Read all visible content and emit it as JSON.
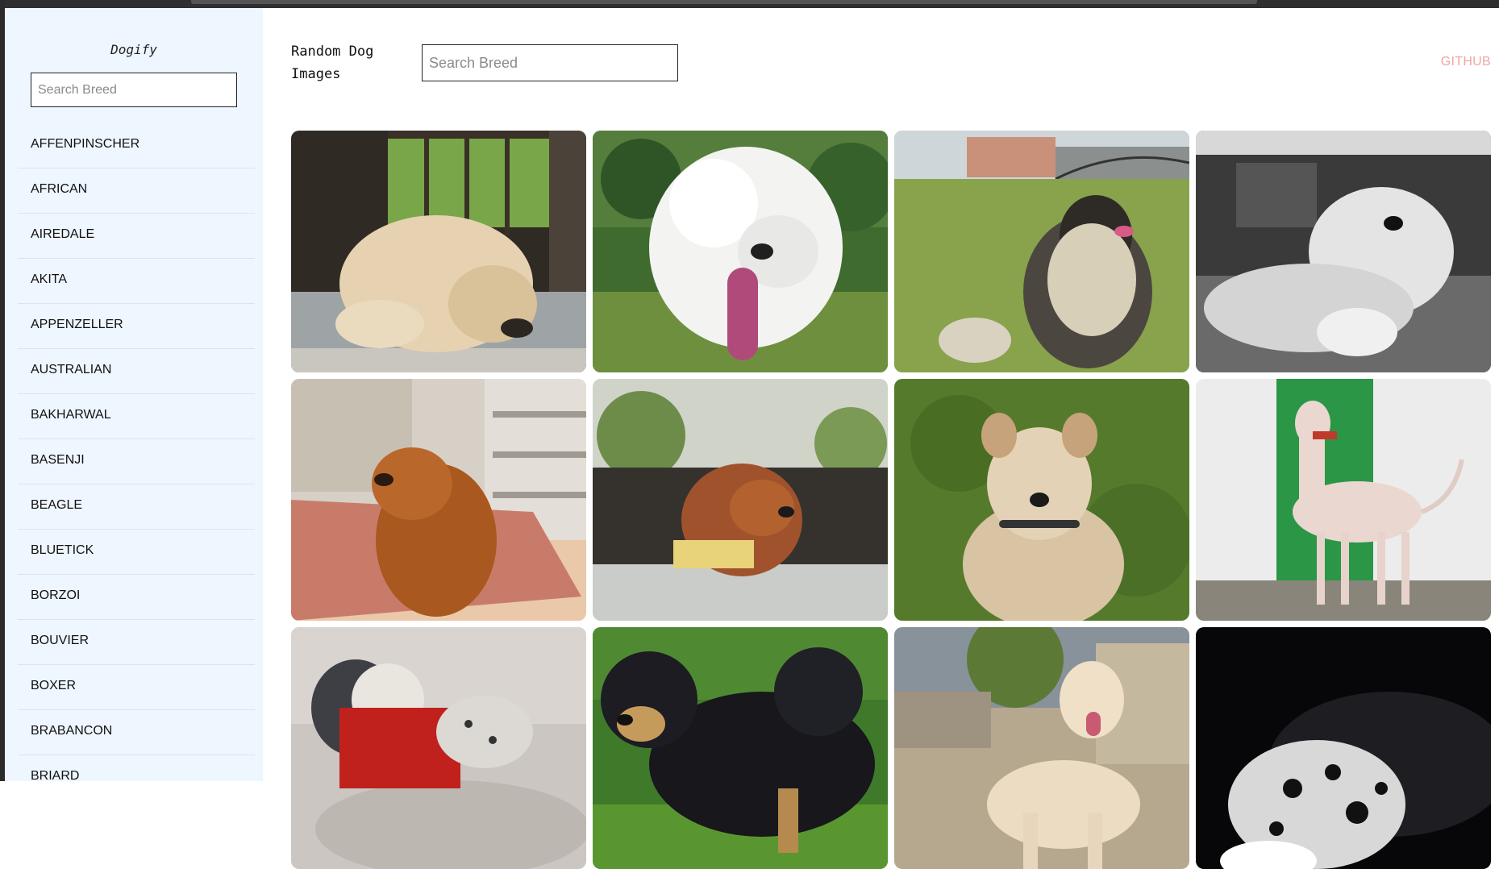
{
  "sidebar": {
    "title": "Dogify",
    "search_placeholder": "Search Breed",
    "breeds": [
      "affenpinscher",
      "african",
      "airedale",
      "akita",
      "appenzeller",
      "australian",
      "bakharwal",
      "basenji",
      "beagle",
      "bluetick",
      "borzoi",
      "bouvier",
      "boxer",
      "brabancon",
      "briard"
    ]
  },
  "header": {
    "title": "Random Dog Images",
    "search_placeholder": "Search Breed",
    "github_label": "GITHUB"
  },
  "colors": {
    "sidebar_bg": "#eef6ff",
    "github_link": "#f0a4a4"
  },
  "images": [
    {
      "subject": "wheaten-terrier-lying"
    },
    {
      "subject": "white-poodle-tongue-out"
    },
    {
      "subject": "keeshond-sitting-on-grass"
    },
    {
      "subject": "havanese-black-and-white"
    },
    {
      "subject": "cocker-spaniel-on-rug"
    },
    {
      "subject": "toy-poodle-in-chair"
    },
    {
      "subject": "lakeland-terrier-on-grass"
    },
    {
      "subject": "white-sighthound-by-green-door"
    },
    {
      "subject": "shar-pei-in-red-sweater"
    },
    {
      "subject": "tibetan-mastiff-on-grass"
    },
    {
      "subject": "white-bully-dog-outdoors"
    },
    {
      "subject": "dalmatian-in-dark"
    }
  ]
}
